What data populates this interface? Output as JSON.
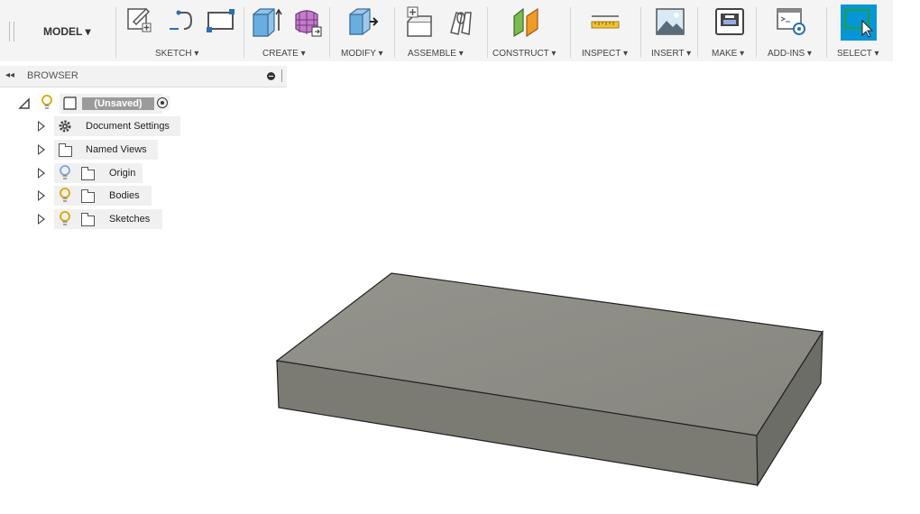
{
  "toolbar": {
    "model_label": "MODEL ▾",
    "groups": [
      {
        "id": "sketch",
        "label": "SKETCH ▾"
      },
      {
        "id": "create",
        "label": "CREATE ▾"
      },
      {
        "id": "modify",
        "label": "MODIFY ▾"
      },
      {
        "id": "assemble",
        "label": "ASSEMBLE ▾"
      },
      {
        "id": "construct",
        "label": "CONSTRUCT ▾"
      },
      {
        "id": "inspect",
        "label": "INSPECT ▾"
      },
      {
        "id": "insert",
        "label": "INSERT ▾"
      },
      {
        "id": "make",
        "label": "MAKE ▾"
      },
      {
        "id": "addins",
        "label": "ADD-INS ▾"
      },
      {
        "id": "select",
        "label": "SELECT ▾"
      }
    ]
  },
  "browser": {
    "collapse_glyph": "◂◂",
    "title": "BROWSER",
    "root": {
      "label": "(Unsaved)"
    },
    "items": [
      {
        "label": "Document Settings"
      },
      {
        "label": "Named Views"
      },
      {
        "label": "Origin"
      },
      {
        "label": "Bodies"
      },
      {
        "label": "Sketches"
      }
    ]
  },
  "colors": {
    "accent": "#0696d7",
    "body_top": "#8f8f88",
    "body_front": "#7b7b74",
    "body_side": "#6d6d67",
    "lightbulb": "#f5c518"
  },
  "icons": {
    "sketch": [
      "create-sketch-icon",
      "spline-icon",
      "rectangle-icon"
    ],
    "create": [
      "extrude-icon",
      "form-icon"
    ],
    "modify": [
      "press-pull-icon"
    ],
    "assemble": [
      "new-component-icon",
      "joint-icon"
    ],
    "construct": [
      "offset-plane-icon"
    ],
    "inspect": [
      "measure-icon"
    ],
    "insert": [
      "insert-image-icon"
    ],
    "make": [
      "3d-print-icon"
    ],
    "addins": [
      "scripts-icon"
    ],
    "select": [
      "select-icon"
    ]
  }
}
